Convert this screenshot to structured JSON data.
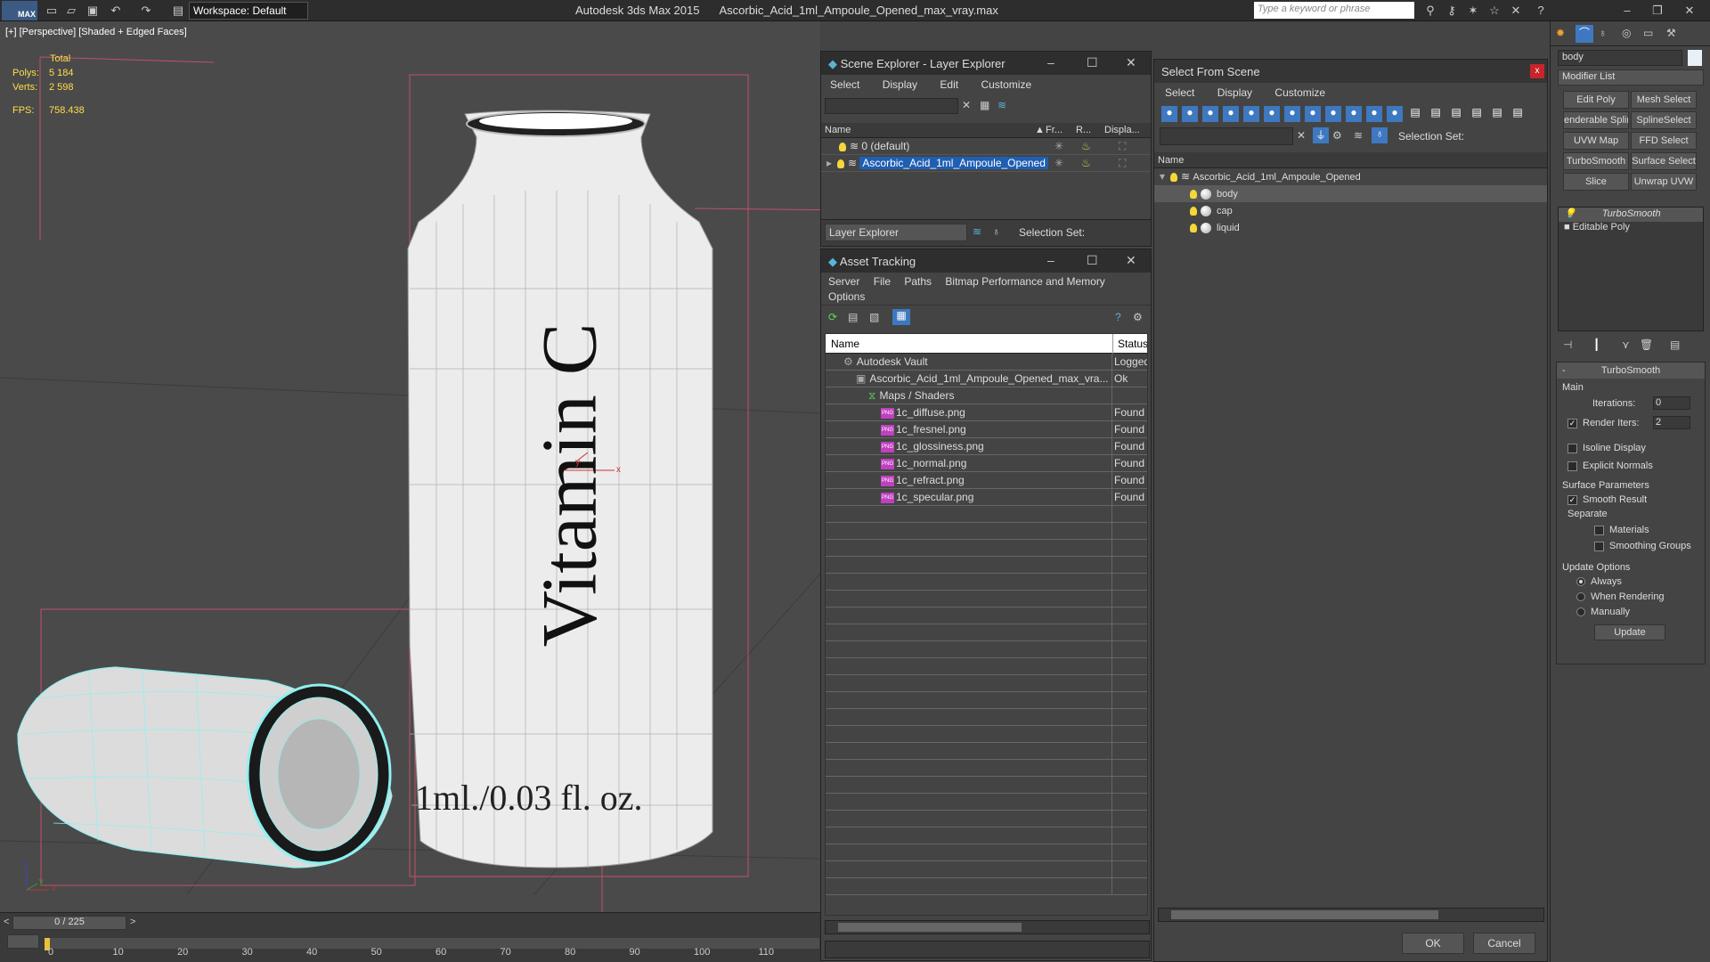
{
  "app": {
    "title": "Autodesk 3ds Max  2015",
    "filename": "Ascorbic_Acid_1ml_Ampoule_Opened_max_vray.max",
    "logo": "MAX",
    "workspace": "Workspace: Default",
    "search_placeholder": "Type a keyword or phrase"
  },
  "viewport": {
    "label": "[+] [Perspective] [Shaded + Edged Faces]",
    "stats_total": "Total",
    "polys_label": "Polys:",
    "polys_value": "5 184",
    "verts_label": "Verts:",
    "verts_value": "2 598",
    "fps_label": "FPS:",
    "fps_value": "758.438",
    "label_text": "Vitamin C",
    "volume_text": "1ml./0.03 fl. oz.",
    "gizmo_x": "x",
    "gizmo_y": "y",
    "axis_x": "x",
    "axis_y": "y",
    "axis_z": "z"
  },
  "timeline": {
    "counter": "0 / 225",
    "prev": "<",
    "next": ">",
    "ticks": [
      "0",
      "10",
      "20",
      "30",
      "40",
      "50",
      "60",
      "70",
      "80",
      "90",
      "100",
      "110",
      "12"
    ]
  },
  "scene_explorer": {
    "title": "Scene Explorer - Layer Explorer",
    "menu": [
      "Select",
      "Display",
      "Edit",
      "Customize"
    ],
    "columns": [
      "Name",
      "Fr...",
      "R...",
      "Displa..."
    ],
    "rows": [
      {
        "name": "0 (default)",
        "selected": false
      },
      {
        "name": "Ascorbic_Acid_1ml_Ampoule_Opened",
        "selected": true
      }
    ],
    "footer_dropdown": "Layer Explorer",
    "selection_set": "Selection Set:"
  },
  "asset_tracking": {
    "title": "Asset Tracking",
    "menu": [
      "Server",
      "File",
      "Paths",
      "Bitmap Performance and Memory",
      "Options"
    ],
    "columns": [
      "Name",
      "Status"
    ],
    "rows": [
      {
        "name": "Autodesk Vault",
        "status": "Logged",
        "indent": 1
      },
      {
        "name": "Ascorbic_Acid_1ml_Ampoule_Opened_max_vra...",
        "status": "Ok",
        "indent": 2
      },
      {
        "name": "Maps / Shaders",
        "status": "",
        "indent": 3
      },
      {
        "name": "1c_diffuse.png",
        "status": "Found",
        "indent": 4
      },
      {
        "name": "1c_fresnel.png",
        "status": "Found",
        "indent": 4
      },
      {
        "name": "1c_glossiness.png",
        "status": "Found",
        "indent": 4
      },
      {
        "name": "1c_normal.png",
        "status": "Found",
        "indent": 4
      },
      {
        "name": "1c_refract.png",
        "status": "Found",
        "indent": 4
      },
      {
        "name": "1c_specular.png",
        "status": "Found",
        "indent": 4
      }
    ],
    "png_icon": "PNG"
  },
  "select_from_scene": {
    "title": "Select From Scene",
    "menu": [
      "Select",
      "Display",
      "Customize"
    ],
    "selection_set": "Selection Set:",
    "column": "Name",
    "root": "Ascorbic_Acid_1ml_Ampoule_Opened",
    "children": [
      {
        "name": "body",
        "selected": true
      },
      {
        "name": "cap",
        "selected": false
      },
      {
        "name": "liquid",
        "selected": false
      }
    ],
    "ok": "OK",
    "cancel": "Cancel",
    "close": "x"
  },
  "command_panel": {
    "object_name": "body",
    "modifier_list": "Modifier List",
    "buttons": [
      "Edit Poly",
      "Mesh Select",
      "enderable Splir",
      "SplineSelect",
      "UVW Map",
      "FFD Select",
      "TurboSmooth",
      "Surface Select",
      "Slice",
      "Unwrap UVW"
    ],
    "stack": [
      "TurboSmooth",
      "Editable Poly"
    ],
    "rollout_title": "TurboSmooth",
    "main": "Main",
    "iterations_label": "Iterations:",
    "iterations_value": "0",
    "render_iters_label": "Render Iters:",
    "render_iters_value": "2",
    "isoline": "Isoline Display",
    "explicit": "Explicit Normals",
    "surface_params": "Surface Parameters",
    "smooth_result": "Smooth Result",
    "separate": "Separate",
    "materials": "Materials",
    "smoothing_groups": "Smoothing Groups",
    "update_options": "Update Options",
    "always": "Always",
    "when_rendering": "When Rendering",
    "manually": "Manually",
    "update": "Update",
    "minus": "-"
  },
  "colors": {
    "selection": "#1e5fb4",
    "accent": "#3b5b85",
    "stats": "#ffde4a",
    "wire": "#8ef0f0"
  }
}
